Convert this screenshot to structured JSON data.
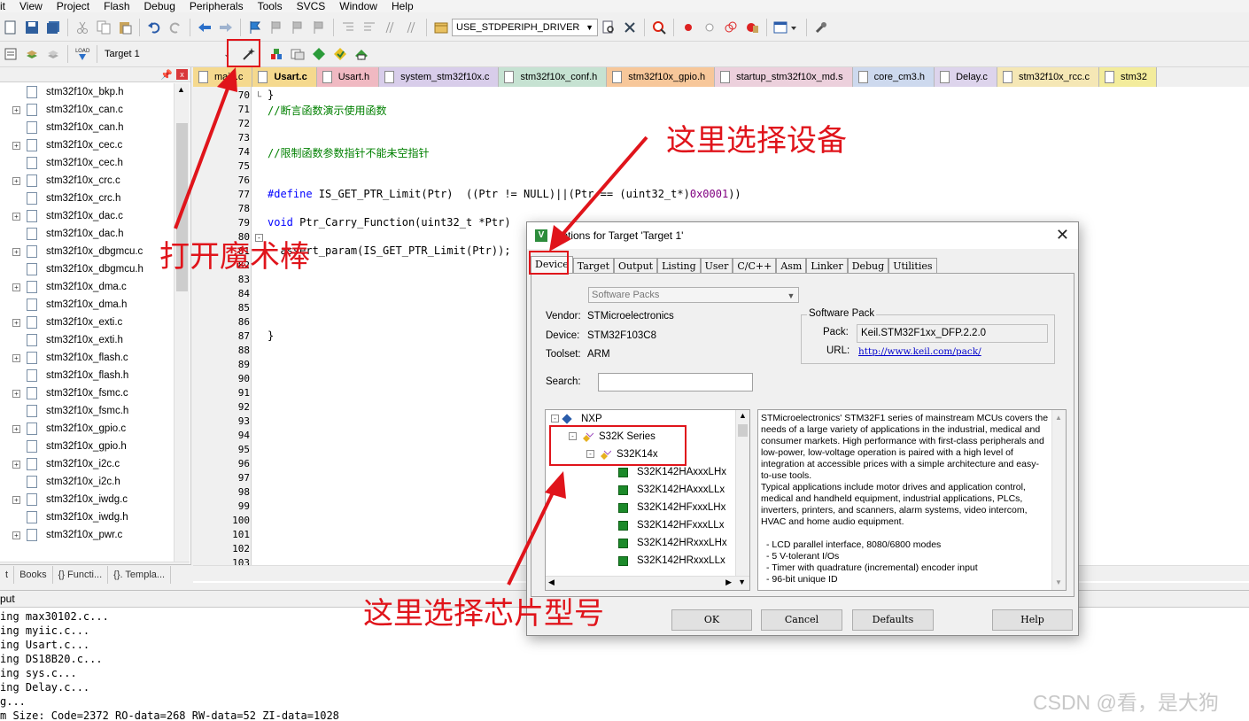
{
  "menu": [
    "it",
    "View",
    "Project",
    "Flash",
    "Debug",
    "Peripherals",
    "Tools",
    "SVCS",
    "Window",
    "Help"
  ],
  "toolbar": {
    "define_combo": "USE_STDPERIPH_DRIVER",
    "target_combo": "Target 1",
    "icons": [
      "save-icon",
      "save-all-icon",
      "cut-icon",
      "copy-icon",
      "paste-icon",
      "undo-icon",
      "redo-icon",
      "back-icon",
      "forward-icon",
      "bookmark-icon",
      "find-icon",
      "debug-icon",
      "options-icon",
      "build-icon",
      "download-icon"
    ]
  },
  "project_pane": {
    "files": [
      "stm32f10x_bkp.h",
      "stm32f10x_can.c",
      "stm32f10x_can.h",
      "stm32f10x_cec.c",
      "stm32f10x_cec.h",
      "stm32f10x_crc.c",
      "stm32f10x_crc.h",
      "stm32f10x_dac.c",
      "stm32f10x_dac.h",
      "stm32f10x_dbgmcu.c",
      "stm32f10x_dbgmcu.h",
      "stm32f10x_dma.c",
      "stm32f10x_dma.h",
      "stm32f10x_exti.c",
      "stm32f10x_exti.h",
      "stm32f10x_flash.c",
      "stm32f10x_flash.h",
      "stm32f10x_fsmc.c",
      "stm32f10x_fsmc.h",
      "stm32f10x_gpio.c",
      "stm32f10x_gpio.h",
      "stm32f10x_i2c.c",
      "stm32f10x_i2c.h",
      "stm32f10x_iwdg.c",
      "stm32f10x_iwdg.h",
      "stm32f10x_pwr.c"
    ],
    "expandable": [
      false,
      true,
      false,
      true,
      false,
      true,
      false,
      true,
      false,
      true,
      false,
      true,
      false,
      true,
      false,
      true,
      false,
      true,
      false,
      true,
      false,
      true,
      false,
      true,
      false,
      true
    ],
    "tabs": [
      "t",
      "Books",
      "{} Functi...",
      "{}. Templa..."
    ]
  },
  "file_tabs": [
    {
      "label": "main.c",
      "color": "#f5d98e",
      "active": false
    },
    {
      "label": "Usart.c",
      "color": "#f5d98e",
      "active": true
    },
    {
      "label": "Usart.h",
      "color": "#f0b9c2",
      "active": false
    },
    {
      "label": "system_stm32f10x.c",
      "color": "#d8cdea",
      "active": false
    },
    {
      "label": "stm32f10x_conf.h",
      "color": "#c6e2d2",
      "active": false
    },
    {
      "label": "stm32f10x_gpio.h",
      "color": "#f7c79a",
      "active": false
    },
    {
      "label": "startup_stm32f10x_md.s",
      "color": "#ecd0dc",
      "active": false
    },
    {
      "label": "core_cm3.h",
      "color": "#cdd9ee",
      "active": false
    },
    {
      "label": "Delay.c",
      "color": "#ddd4ec",
      "active": false
    },
    {
      "label": "stm32f10x_rcc.c",
      "color": "#f5e7b5",
      "active": false
    },
    {
      "label": "stm32",
      "color": "#f3ec9c",
      "active": false
    }
  ],
  "editor": {
    "line_numbers": [
      "70",
      "71",
      "72",
      "73",
      "74",
      "75",
      "76",
      "77",
      "78",
      "79",
      "80",
      "81",
      "82",
      "83",
      "84",
      "85",
      "86",
      "87",
      "88",
      "89",
      "90",
      "91",
      "92",
      "93",
      "94",
      "95",
      "96",
      "97",
      "98",
      "99",
      "100",
      "101",
      "102",
      "103"
    ],
    "code": {
      "l70": "}",
      "l71": "//断言函数演示使用函数",
      "l74": "//限制函数参数指针不能未空指针",
      "l77_kw": "#define",
      "l77_rest": " IS_GET_PTR_Limit(Ptr)  ((Ptr != NULL)||(Ptr == (uint32_t*)",
      "l77_num": "0x0001",
      "l77_end": "))",
      "l79_kw": "void",
      "l79_rest": " Ptr_Carry_Function(uint32_t *Ptr)",
      "l81": "  assert_param(IS_GET_PTR_Limit(Ptr));",
      "l86": "}"
    }
  },
  "output": {
    "header": "put",
    "lines": [
      "ing max30102.c...",
      "ing myiic.c...",
      "ing Usart.c...",
      "ing DS18B20.c...",
      "ing sys.c...",
      "ing Delay.c...",
      "g...",
      "m Size: Code=2372 RO-data=268 RW-data=52 ZI-data=1028"
    ]
  },
  "dialog": {
    "title": "Options for Target 'Target 1'",
    "tabs": [
      "Device",
      "Target",
      "Output",
      "Listing",
      "User",
      "C/C++",
      "Asm",
      "Linker",
      "Debug",
      "Utilities"
    ],
    "active_tab": "Device",
    "software_packs_select": "Software Packs",
    "vendor_label": "Vendor:",
    "vendor": "STMicroelectronics",
    "device_label": "Device:",
    "device": "STM32F103C8",
    "toolset_label": "Toolset:",
    "toolset": "ARM",
    "search_label": "Search:",
    "software_pack": {
      "group_title": "Software Pack",
      "pack_label": "Pack:",
      "pack": "Keil.STM32F1xx_DFP.2.2.0",
      "url_label": "URL:",
      "url": "http://www.keil.com/pack/"
    },
    "device_tree": {
      "vendor": "NXP",
      "series": "S32K Series",
      "family": "S32K14x",
      "devices": [
        "S32K142HAxxxLHx",
        "S32K142HAxxxLLx",
        "S32K142HFxxxLHx",
        "S32K142HFxxxLLx",
        "S32K142HRxxxLHx",
        "S32K142HRxxxLLx"
      ]
    },
    "description": {
      "paragraphs": [
        "STMicroelectronics' STM32F1 series of mainstream MCUs covers the needs of a large variety of applications in the industrial, medical and consumer markets. High performance with first-class peripherals and low-power, low-voltage operation is paired with a high level of integration at accessible prices with a simple architecture and easy-to-use tools.",
        "Typical applications include motor drives and application control, medical and handheld equipment, industrial applications, PLCs, inverters, printers, and scanners, alarm systems, video intercom, HVAC and home audio equipment."
      ],
      "bullets": [
        "- LCD parallel interface, 8080/6800 modes",
        "- 5 V-tolerant I/Os",
        "- Timer with quadrature (incremental) encoder input",
        "- 96-bit unique ID"
      ]
    },
    "buttons": {
      "ok": "OK",
      "cancel": "Cancel",
      "defaults": "Defaults",
      "help": "Help"
    }
  },
  "annotations": {
    "magic_wand": "打开魔术棒",
    "select_device": "这里选择设备",
    "select_chip": "这里选择芯片型号",
    "color": "#e0141b"
  },
  "watermark": "CSDN @看，是大狗"
}
